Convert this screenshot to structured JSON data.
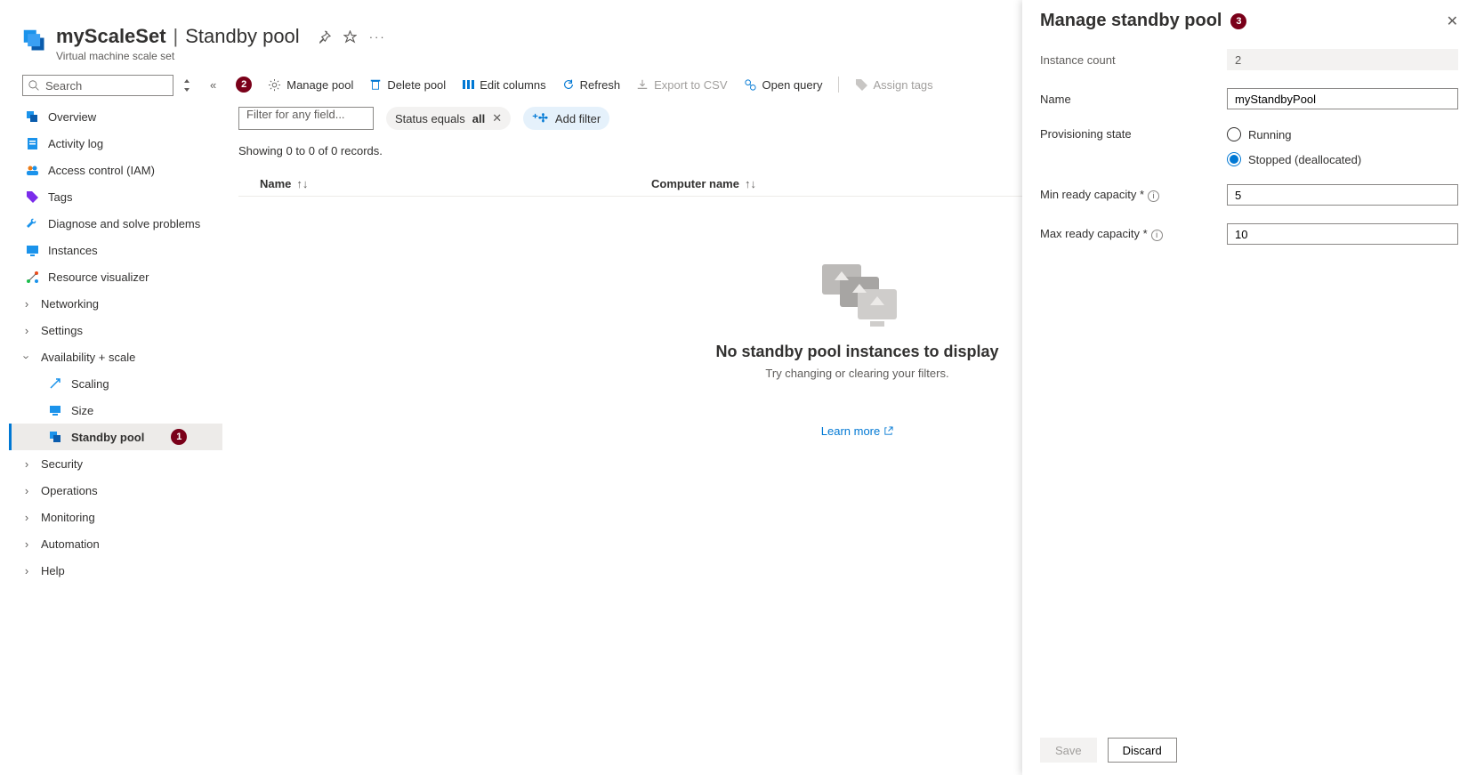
{
  "header": {
    "resource_name": "myScaleSet",
    "separator": "|",
    "blade_name": "Standby pool",
    "subtitle": "Virtual machine scale set"
  },
  "search": {
    "placeholder": "Search"
  },
  "nav": {
    "items": [
      {
        "label": "Overview"
      },
      {
        "label": "Activity log"
      },
      {
        "label": "Access control (IAM)"
      },
      {
        "label": "Tags"
      },
      {
        "label": "Diagnose and solve problems"
      },
      {
        "label": "Instances"
      },
      {
        "label": "Resource visualizer"
      }
    ],
    "groups": {
      "networking": "Networking",
      "settings": "Settings",
      "availability": "Availability + scale",
      "security": "Security",
      "operations": "Operations",
      "monitoring": "Monitoring",
      "automation": "Automation",
      "help": "Help"
    },
    "availability_children": {
      "scaling": "Scaling",
      "size": "Size",
      "standby_pool": "Standby pool"
    }
  },
  "callouts": {
    "one": "1",
    "two": "2",
    "three": "3"
  },
  "toolbar": {
    "manage_pool": "Manage pool",
    "delete_pool": "Delete pool",
    "edit_columns": "Edit columns",
    "refresh": "Refresh",
    "export_csv": "Export to CSV",
    "open_query": "Open query",
    "assign_tags": "Assign tags"
  },
  "filters": {
    "field_placeholder": "Filter for any field...",
    "status_label": "Status equals ",
    "status_value": "all",
    "add_filter": "Add filter"
  },
  "records_line": "Showing 0 to 0 of 0 records.",
  "columns": {
    "name": "Name",
    "computer": "Computer name"
  },
  "empty": {
    "title": "No standby pool instances to display",
    "subtitle": "Try changing or clearing your filters.",
    "learn_more": "Learn more"
  },
  "flyout": {
    "title": "Manage standby pool",
    "fields": {
      "instance_count_label": "Instance count",
      "instance_count_value": "2",
      "name_label": "Name",
      "name_value": "myStandbyPool",
      "prov_label": "Provisioning state",
      "prov_running": "Running",
      "prov_stopped": "Stopped (deallocated)",
      "min_label": "Min ready capacity",
      "min_value": "5",
      "max_label": "Max ready capacity",
      "max_value": "10"
    },
    "buttons": {
      "save": "Save",
      "discard": "Discard"
    }
  }
}
